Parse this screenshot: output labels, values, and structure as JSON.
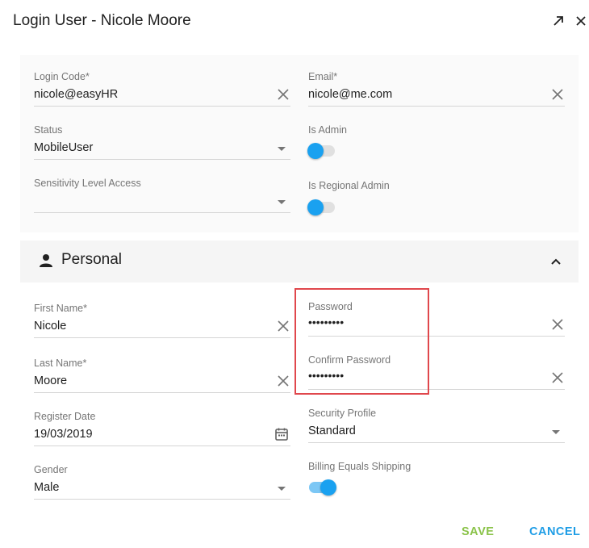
{
  "dialog": {
    "title": "Login User - Nicole Moore"
  },
  "account": {
    "login_code": {
      "label": "Login Code*",
      "value": "nicole@easyHR"
    },
    "email": {
      "label": "Email*",
      "value": "nicole@me.com"
    },
    "status": {
      "label": "Status",
      "value": "MobileUser"
    },
    "is_admin": {
      "label": "Is Admin",
      "checked": false
    },
    "sensitivity": {
      "label": "Sensitivity Level Access",
      "value": ""
    },
    "is_regional_admin": {
      "label": "Is Regional Admin",
      "checked": false
    }
  },
  "personal": {
    "section_title": "Personal",
    "first_name": {
      "label": "First Name*",
      "value": "Nicole"
    },
    "password": {
      "label": "Password",
      "value": "•••••••••"
    },
    "last_name": {
      "label": "Last Name*",
      "value": "Moore"
    },
    "confirm_password": {
      "label": "Confirm Password",
      "value": "•••••••••"
    },
    "register_date": {
      "label": "Register Date",
      "value": "19/03/2019"
    },
    "security_profile": {
      "label": "Security Profile",
      "value": "Standard"
    },
    "gender": {
      "label": "Gender",
      "value": "Male"
    },
    "billing_equals_shipping": {
      "label": "Billing Equals Shipping",
      "checked": true
    }
  },
  "actions": {
    "save_label": "SAVE",
    "cancel_label": "CANCEL"
  },
  "colors": {
    "accent": "#1aa1f0",
    "save": "#8bc34a",
    "cancel": "#1e9de6",
    "highlight": "#e0474c"
  }
}
